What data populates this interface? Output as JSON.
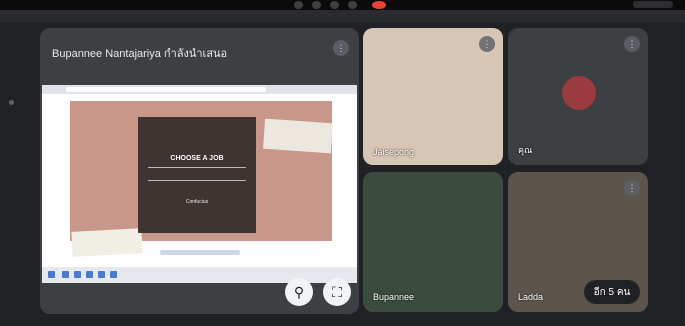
{
  "presentation": {
    "title": "Bupannee Nantajariya กำลังนำเสนอ",
    "slide_heading": "CHOOSE A JOB",
    "slide_footer": "Confucius"
  },
  "participants": [
    {
      "name": "Jaisepong"
    },
    {
      "name": "คุณ"
    },
    {
      "name": "Bupannee"
    },
    {
      "name": "Ladda"
    }
  ],
  "more_participants_label": "อีก 5 คน",
  "colors": {
    "background": "#202124",
    "tile": "#3c4043",
    "end_call": "#ea4335"
  }
}
